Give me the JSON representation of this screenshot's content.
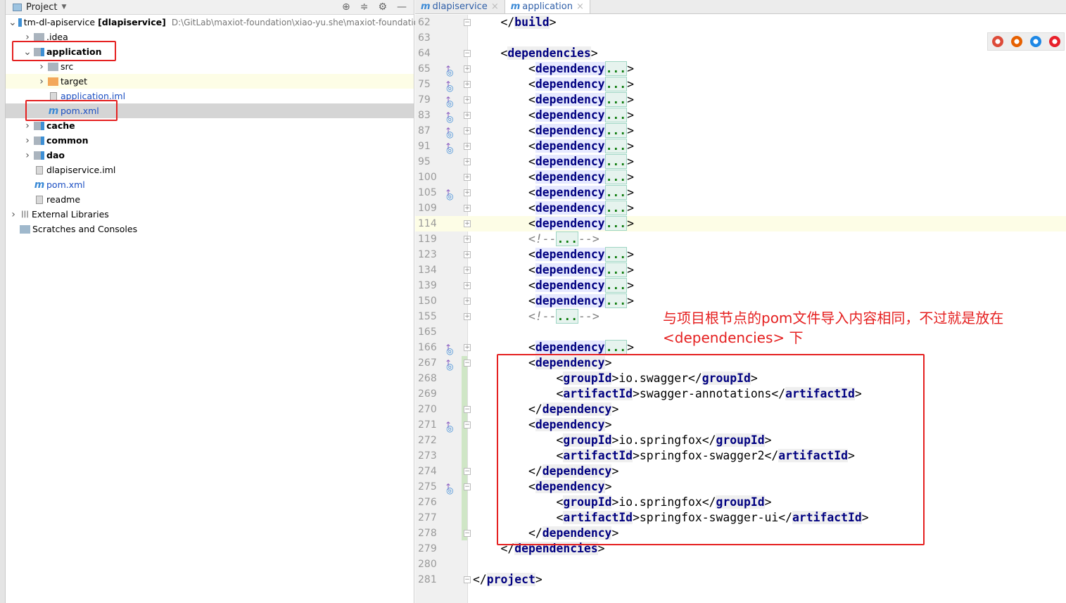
{
  "project_panel": {
    "title": "Project",
    "tools": [
      "⊕",
      "≑",
      "⚙",
      "—"
    ],
    "tree": [
      {
        "label": "tm-dl-apiservice",
        "extra": "[dlapiservice]",
        "path": "D:\\GitLab\\maxiot-foundation\\xiao-yu.she\\maxiot-foundation\\",
        "depth": 0,
        "chev": "open",
        "icon": "module"
      },
      {
        "label": ".idea",
        "depth": 1,
        "chev": "closed",
        "icon": "folder"
      },
      {
        "label": "application",
        "depth": 1,
        "chev": "open",
        "icon": "module",
        "bold": true
      },
      {
        "label": "src",
        "depth": 2,
        "chev": "closed",
        "icon": "folder"
      },
      {
        "label": "target",
        "depth": 2,
        "chev": "closed",
        "icon": "folder-orange",
        "highlight": true
      },
      {
        "label": "application.iml",
        "depth": 2,
        "icon": "file",
        "blue": true
      },
      {
        "label": "pom.xml",
        "depth": 2,
        "icon": "maven",
        "blue": true,
        "selected": true
      },
      {
        "label": "cache",
        "depth": 1,
        "chev": "closed",
        "icon": "module",
        "bold": true
      },
      {
        "label": "common",
        "depth": 1,
        "chev": "closed",
        "icon": "module",
        "bold": true
      },
      {
        "label": "dao",
        "depth": 1,
        "chev": "closed",
        "icon": "module",
        "bold": true
      },
      {
        "label": "dlapiservice.iml",
        "depth": 1,
        "icon": "file"
      },
      {
        "label": "pom.xml",
        "depth": 1,
        "icon": "maven",
        "blue": true
      },
      {
        "label": "readme",
        "depth": 1,
        "icon": "file"
      },
      {
        "label": "External Libraries",
        "depth": 0,
        "chev": "closed",
        "icon": "library"
      },
      {
        "label": "Scratches and Consoles",
        "depth": 0,
        "icon": "scratch"
      }
    ]
  },
  "tabs": [
    {
      "label": "dlapiservice",
      "active": false
    },
    {
      "label": "application",
      "active": true
    }
  ],
  "editor": {
    "current_line": "114",
    "lines": [
      {
        "n": "62",
        "i": 1,
        "f": "-",
        "p": [
          [
            "</",
            "b"
          ],
          [
            "build",
            "t"
          ],
          [
            ">",
            "b"
          ]
        ]
      },
      {
        "n": "63",
        "i": 0,
        "p": []
      },
      {
        "n": "64",
        "i": 1,
        "f": "-",
        "p": [
          [
            "<",
            "b"
          ],
          [
            "dependencies",
            "t"
          ],
          [
            ">",
            "b"
          ]
        ]
      },
      {
        "n": "65",
        "i": 2,
        "o": true,
        "f": "+",
        "p": [
          [
            "<",
            "b"
          ],
          [
            "dependency",
            "d"
          ],
          [
            "...",
            "ph"
          ],
          [
            ">",
            "b"
          ]
        ]
      },
      {
        "n": "75",
        "i": 2,
        "o": true,
        "f": "+",
        "p": [
          [
            "<",
            "b"
          ],
          [
            "dependency",
            "d"
          ],
          [
            "...",
            "ph"
          ],
          [
            ">",
            "b"
          ]
        ]
      },
      {
        "n": "79",
        "i": 2,
        "o": true,
        "f": "+",
        "p": [
          [
            "<",
            "b"
          ],
          [
            "dependency",
            "d"
          ],
          [
            "...",
            "ph"
          ],
          [
            ">",
            "b"
          ]
        ]
      },
      {
        "n": "83",
        "i": 2,
        "o": true,
        "f": "+",
        "p": [
          [
            "<",
            "b"
          ],
          [
            "dependency",
            "d"
          ],
          [
            "...",
            "ph"
          ],
          [
            ">",
            "b"
          ]
        ]
      },
      {
        "n": "87",
        "i": 2,
        "o": true,
        "f": "+",
        "p": [
          [
            "<",
            "b"
          ],
          [
            "dependency",
            "d"
          ],
          [
            "...",
            "ph"
          ],
          [
            ">",
            "b"
          ]
        ]
      },
      {
        "n": "91",
        "i": 2,
        "o": true,
        "f": "+",
        "p": [
          [
            "<",
            "b"
          ],
          [
            "dependency",
            "d"
          ],
          [
            "...",
            "ph"
          ],
          [
            ">",
            "b"
          ]
        ]
      },
      {
        "n": "95",
        "i": 2,
        "f": "+",
        "p": [
          [
            "<",
            "b"
          ],
          [
            "dependency",
            "d"
          ],
          [
            "...",
            "ph"
          ],
          [
            ">",
            "b"
          ]
        ]
      },
      {
        "n": "100",
        "i": 2,
        "f": "+",
        "p": [
          [
            "<",
            "b"
          ],
          [
            "dependency",
            "d"
          ],
          [
            "...",
            "ph"
          ],
          [
            ">",
            "b"
          ]
        ]
      },
      {
        "n": "105",
        "i": 2,
        "o": true,
        "f": "+",
        "p": [
          [
            "<",
            "b"
          ],
          [
            "dependency",
            "d"
          ],
          [
            "...",
            "ph"
          ],
          [
            ">",
            "b"
          ]
        ]
      },
      {
        "n": "109",
        "i": 2,
        "f": "+",
        "p": [
          [
            "<",
            "b"
          ],
          [
            "dependency",
            "d"
          ],
          [
            "...",
            "ph"
          ],
          [
            ">",
            "b"
          ]
        ]
      },
      {
        "n": "114",
        "i": 2,
        "f": "+",
        "p": [
          [
            "<",
            "b"
          ],
          [
            "dependency",
            "d"
          ],
          [
            "...",
            "ph"
          ],
          [
            ">",
            "b"
          ]
        ]
      },
      {
        "n": "119",
        "i": 2,
        "f": "+",
        "p": [
          [
            "<!--",
            "c"
          ],
          [
            "...",
            "ph"
          ],
          [
            "-->",
            "c"
          ]
        ]
      },
      {
        "n": "123",
        "i": 2,
        "f": "+",
        "p": [
          [
            "<",
            "b"
          ],
          [
            "dependency",
            "d"
          ],
          [
            "...",
            "ph"
          ],
          [
            ">",
            "b"
          ]
        ]
      },
      {
        "n": "134",
        "i": 2,
        "f": "+",
        "p": [
          [
            "<",
            "b"
          ],
          [
            "dependency",
            "d"
          ],
          [
            "...",
            "ph"
          ],
          [
            ">",
            "b"
          ]
        ]
      },
      {
        "n": "139",
        "i": 2,
        "f": "+",
        "p": [
          [
            "<",
            "b"
          ],
          [
            "dependency",
            "d"
          ],
          [
            "...",
            "ph"
          ],
          [
            ">",
            "b"
          ]
        ]
      },
      {
        "n": "150",
        "i": 2,
        "f": "+",
        "p": [
          [
            "<",
            "b"
          ],
          [
            "dependency",
            "d"
          ],
          [
            "...",
            "ph"
          ],
          [
            ">",
            "b"
          ]
        ]
      },
      {
        "n": "155",
        "i": 2,
        "f": "+",
        "p": [
          [
            "<!--",
            "c"
          ],
          [
            "...",
            "ph"
          ],
          [
            "-->",
            "c"
          ]
        ]
      },
      {
        "n": "165",
        "i": 0,
        "p": []
      },
      {
        "n": "166",
        "i": 2,
        "o": true,
        "f": "+",
        "p": [
          [
            "<",
            "b"
          ],
          [
            "dependency",
            "d"
          ],
          [
            "...",
            "ph"
          ],
          [
            ">",
            "b"
          ]
        ]
      },
      {
        "n": "267",
        "i": 2,
        "o": true,
        "f": "-",
        "p": [
          [
            "<",
            "b"
          ],
          [
            "dependency",
            "t"
          ],
          [
            ">",
            "b"
          ]
        ]
      },
      {
        "n": "268",
        "i": 3,
        "p": [
          [
            "<",
            "b"
          ],
          [
            "groupId",
            "t"
          ],
          [
            ">io.swagger</",
            "b"
          ],
          [
            "groupId",
            "t"
          ],
          [
            ">",
            "b"
          ]
        ]
      },
      {
        "n": "269",
        "i": 3,
        "p": [
          [
            "<",
            "b"
          ],
          [
            "artifactId",
            "t"
          ],
          [
            ">swagger-annotations</",
            "b"
          ],
          [
            "artifactId",
            "t"
          ],
          [
            ">",
            "b"
          ]
        ]
      },
      {
        "n": "270",
        "i": 2,
        "f": "-",
        "p": [
          [
            "</",
            "b"
          ],
          [
            "dependency",
            "t"
          ],
          [
            ">",
            "b"
          ]
        ]
      },
      {
        "n": "271",
        "i": 2,
        "o": true,
        "f": "-",
        "p": [
          [
            "<",
            "b"
          ],
          [
            "dependency",
            "t"
          ],
          [
            ">",
            "b"
          ]
        ]
      },
      {
        "n": "272",
        "i": 3,
        "p": [
          [
            "<",
            "b"
          ],
          [
            "groupId",
            "t"
          ],
          [
            ">io.springfox</",
            "b"
          ],
          [
            "groupId",
            "t"
          ],
          [
            ">",
            "b"
          ]
        ]
      },
      {
        "n": "273",
        "i": 3,
        "p": [
          [
            "<",
            "b"
          ],
          [
            "artifactId",
            "t"
          ],
          [
            ">springfox-swagger2</",
            "b"
          ],
          [
            "artifactId",
            "t"
          ],
          [
            ">",
            "b"
          ]
        ]
      },
      {
        "n": "274",
        "i": 2,
        "f": "-",
        "p": [
          [
            "</",
            "b"
          ],
          [
            "dependency",
            "t"
          ],
          [
            ">",
            "b"
          ]
        ]
      },
      {
        "n": "275",
        "i": 2,
        "o": true,
        "f": "-",
        "p": [
          [
            "<",
            "b"
          ],
          [
            "dependency",
            "t"
          ],
          [
            ">",
            "b"
          ]
        ]
      },
      {
        "n": "276",
        "i": 3,
        "p": [
          [
            "<",
            "b"
          ],
          [
            "groupId",
            "t"
          ],
          [
            ">io.springfox</",
            "b"
          ],
          [
            "groupId",
            "t"
          ],
          [
            ">",
            "b"
          ]
        ]
      },
      {
        "n": "277",
        "i": 3,
        "p": [
          [
            "<",
            "b"
          ],
          [
            "artifactId",
            "t"
          ],
          [
            ">springfox-swagger-ui</",
            "b"
          ],
          [
            "artifactId",
            "t"
          ],
          [
            ">",
            "b"
          ]
        ]
      },
      {
        "n": "278",
        "i": 2,
        "f": "-",
        "p": [
          [
            "</",
            "b"
          ],
          [
            "dependency",
            "t"
          ],
          [
            ">",
            "b"
          ]
        ]
      },
      {
        "n": "279",
        "i": 1,
        "p": [
          [
            "</",
            "b"
          ],
          [
            "dependencies",
            "t"
          ],
          [
            ">",
            "b"
          ]
        ]
      },
      {
        "n": "280",
        "i": 0,
        "p": []
      },
      {
        "n": "281",
        "i": 0,
        "f": "-",
        "p": [
          [
            "</",
            "b"
          ],
          [
            "project",
            "t"
          ],
          [
            ">",
            "b"
          ]
        ]
      }
    ]
  },
  "annotation": {
    "line1": "与项目根节点的pom文件导入内容相同，不过就是放在",
    "line2": "<dependencies> 下",
    "color": "#e52020"
  },
  "browser_icons": [
    {
      "name": "chrome",
      "color": "#dd4b39"
    },
    {
      "name": "firefox",
      "color": "#e66000"
    },
    {
      "name": "safari",
      "color": "#1e88e5"
    },
    {
      "name": "opera",
      "color": "#e8202a"
    }
  ]
}
